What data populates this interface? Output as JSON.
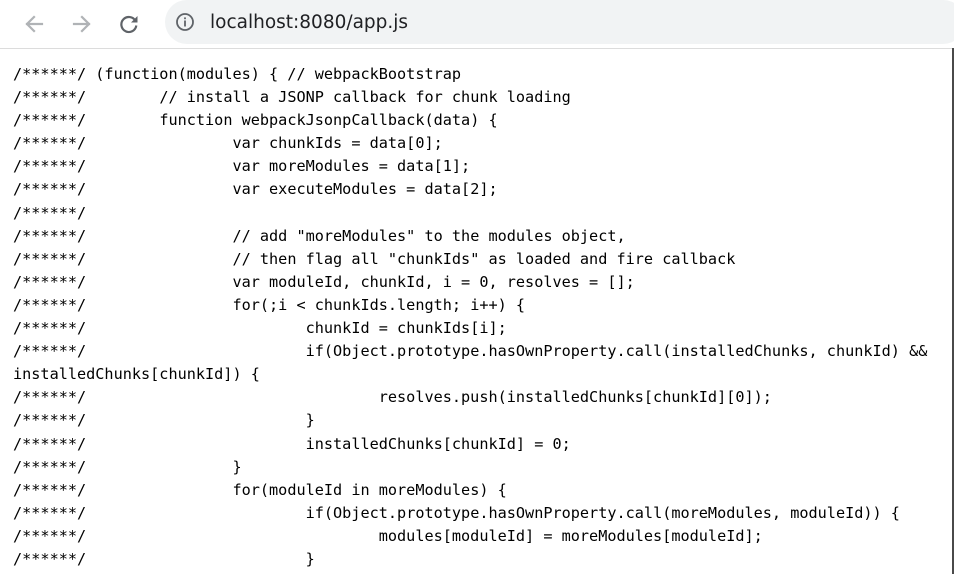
{
  "browser": {
    "url": "localhost:8080/app.js",
    "back_icon": "arrow-left-icon",
    "forward_icon": "arrow-right-icon",
    "reload_icon": "reload-icon",
    "info_icon": "info-circle-icon"
  },
  "code": {
    "lines": [
      "/******/ (function(modules) { // webpackBootstrap",
      "/******/ \t// install a JSONP callback for chunk loading",
      "/******/ \tfunction webpackJsonpCallback(data) {",
      "/******/ \t\tvar chunkIds = data[0];",
      "/******/ \t\tvar moreModules = data[1];",
      "/******/ \t\tvar executeModules = data[2];",
      "/******/",
      "/******/ \t\t// add \"moreModules\" to the modules object,",
      "/******/ \t\t// then flag all \"chunkIds\" as loaded and fire callback",
      "/******/ \t\tvar moduleId, chunkId, i = 0, resolves = [];",
      "/******/ \t\tfor(;i < chunkIds.length; i++) {",
      "/******/ \t\t\tchunkId = chunkIds[i];",
      "/******/ \t\t\tif(Object.prototype.hasOwnProperty.call(installedChunks, chunkId) &&",
      "installedChunks[chunkId]) {",
      "/******/ \t\t\t\tresolves.push(installedChunks[chunkId][0]);",
      "/******/ \t\t\t}",
      "/******/ \t\t\tinstalledChunks[chunkId] = 0;",
      "/******/ \t\t}",
      "/******/ \t\tfor(moduleId in moreModules) {",
      "/******/ \t\t\tif(Object.prototype.hasOwnProperty.call(moreModules, moduleId)) {",
      "/******/ \t\t\t\tmodules[moduleId] = moreModules[moduleId];",
      "/******/ \t\t\t}"
    ]
  }
}
